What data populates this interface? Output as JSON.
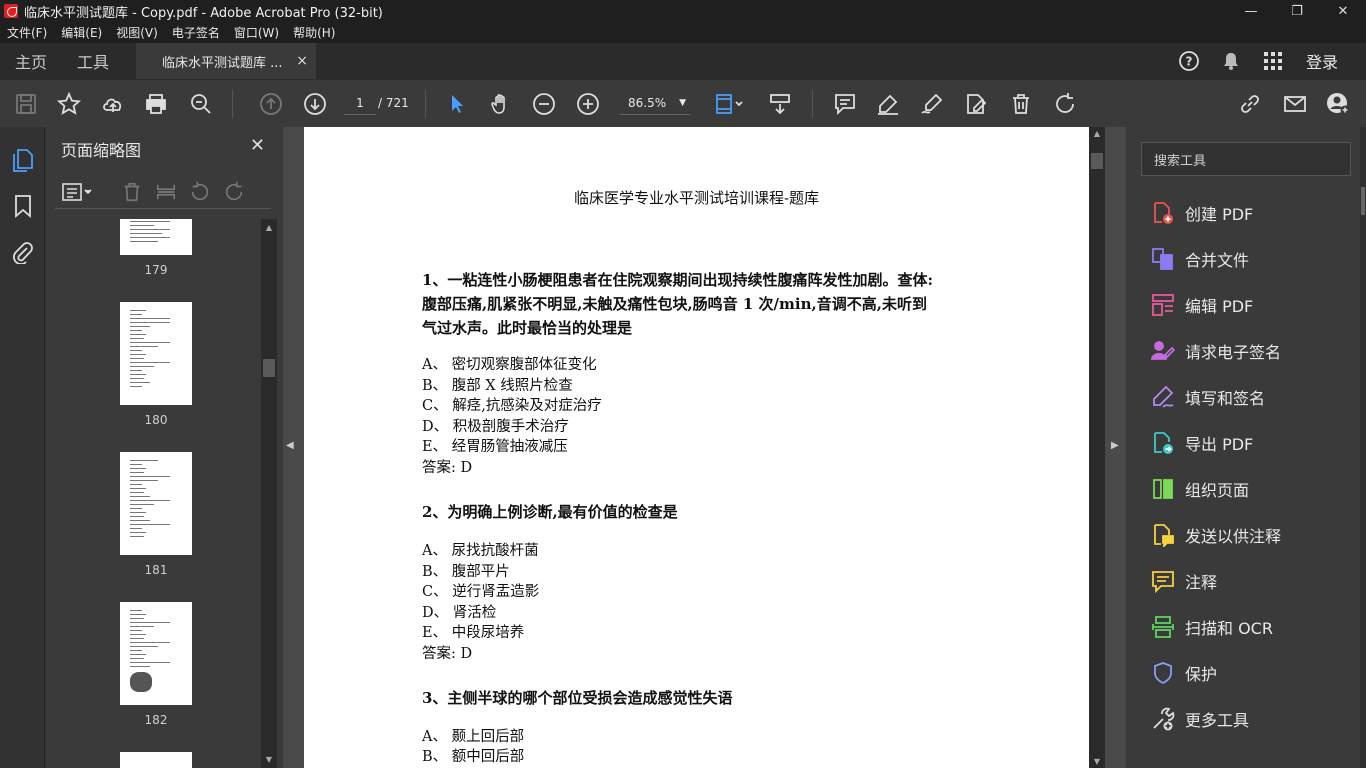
{
  "window": {
    "title": "临床水平测试题库 - Copy.pdf - Adobe Acrobat Pro (32-bit)",
    "minimize": "—",
    "restore": "❐",
    "close": "✕"
  },
  "menu": [
    "文件(F)",
    "编辑(E)",
    "视图(V)",
    "电子签名",
    "窗口(W)",
    "帮助(H)"
  ],
  "tabs": {
    "home": "主页",
    "tools": "工具",
    "doc": "临床水平测试题库 ...",
    "doc_close": "×",
    "login": "登录"
  },
  "toolbar": {
    "page_current": "1",
    "page_total": "/ 721",
    "zoom": "86.5%"
  },
  "thumbnails": {
    "header": "页面缩略图",
    "close": "✕",
    "pages": [
      "179",
      "180",
      "181",
      "182"
    ]
  },
  "document": {
    "title": "临床医学专业水平测试培训课程-题库",
    "q1_line1": "1、一粘连性小肠梗阻患者在住院观察期间出现持续性腹痛阵发性加剧。查体:",
    "q1_line2": "腹部压痛,肌紧张不明显,未触及痛性包块,肠鸣音 1 次/min,音调不高,未听到",
    "q1_line3": "气过水声。此时最恰当的处理是",
    "q1_options": [
      "A、 密切观察腹部体征变化",
      "B、 腹部 X 线照片检查",
      "C、 解痉,抗感染及对症治疗",
      "D、 积极剖腹手术治疗",
      "E、 经胃肠管抽液减压"
    ],
    "q1_answer": "答案:  D",
    "q2": "2、为明确上例诊断,最有价值的检查是",
    "q2_options": [
      "A、 尿找抗酸杆菌",
      "B、 腹部平片",
      "C、 逆行肾盂造影",
      "D、 肾活检",
      "E、 中段尿培养"
    ],
    "q2_answer": "答案:  D",
    "q3": "3、主侧半球的哪个部位受损会造成感觉性失语",
    "q3_options": [
      "A、 颞上回后部",
      "B、 额中回后部"
    ]
  },
  "right_panel": {
    "search_placeholder": "搜索工具",
    "tools": [
      {
        "label": "创建 PDF",
        "icon": "create-pdf-icon",
        "color": "#e8554e"
      },
      {
        "label": "合并文件",
        "icon": "combine-files-icon",
        "color": "#8b7cf6"
      },
      {
        "label": "编辑 PDF",
        "icon": "edit-pdf-icon",
        "color": "#e85a9a"
      },
      {
        "label": "请求电子签名",
        "icon": "request-signature-icon",
        "color": "#c46be0"
      },
      {
        "label": "填写和签名",
        "icon": "fill-sign-icon",
        "color": "#b58af0"
      },
      {
        "label": "导出 PDF",
        "icon": "export-pdf-icon",
        "color": "#3ec9c9"
      },
      {
        "label": "组织页面",
        "icon": "organize-pages-icon",
        "color": "#7ed957"
      },
      {
        "label": "发送以供注释",
        "icon": "send-comments-icon",
        "color": "#f5d142"
      },
      {
        "label": "注释",
        "icon": "comment-icon",
        "color": "#f5d142"
      },
      {
        "label": "扫描和 OCR",
        "icon": "scan-ocr-icon",
        "color": "#5fd35f"
      },
      {
        "label": "保护",
        "icon": "protect-icon",
        "color": "#8b9cf6"
      },
      {
        "label": "更多工具",
        "icon": "more-tools-icon",
        "color": "#dddddd"
      }
    ]
  }
}
